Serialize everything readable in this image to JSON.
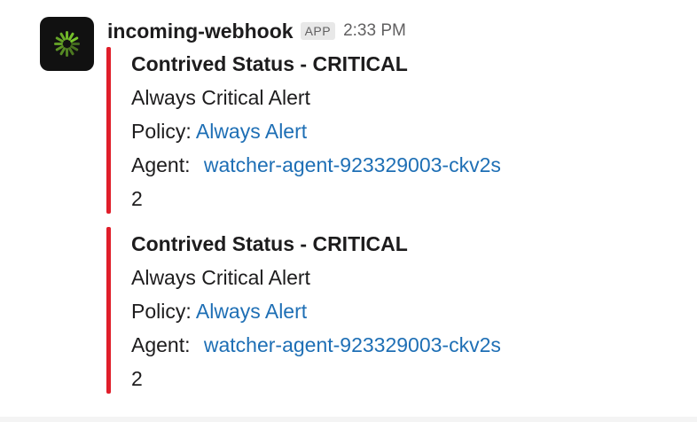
{
  "message": {
    "sender": "incoming-webhook",
    "badge": "APP",
    "time": "2:33 PM",
    "avatar_icon": "spinner-logo-icon",
    "colors": {
      "accent_bar": "#e01e2a",
      "link": "#1e6fb5",
      "avatar_bg": "#111111",
      "logo_green": "#7fd12e"
    }
  },
  "attachments": [
    {
      "title": "Contrived Status - CRITICAL",
      "description": "Always Critical Alert",
      "policy_label": "Policy:",
      "policy_link": "Always Alert",
      "agent_label": "Agent:",
      "agent_link": "watcher-agent-923329003-ckv2s",
      "count": "2"
    },
    {
      "title": "Contrived Status - CRITICAL",
      "description": "Always Critical Alert",
      "policy_label": "Policy:",
      "policy_link": "Always Alert",
      "agent_label": "Agent:",
      "agent_link": "watcher-agent-923329003-ckv2s",
      "count": "2"
    }
  ]
}
